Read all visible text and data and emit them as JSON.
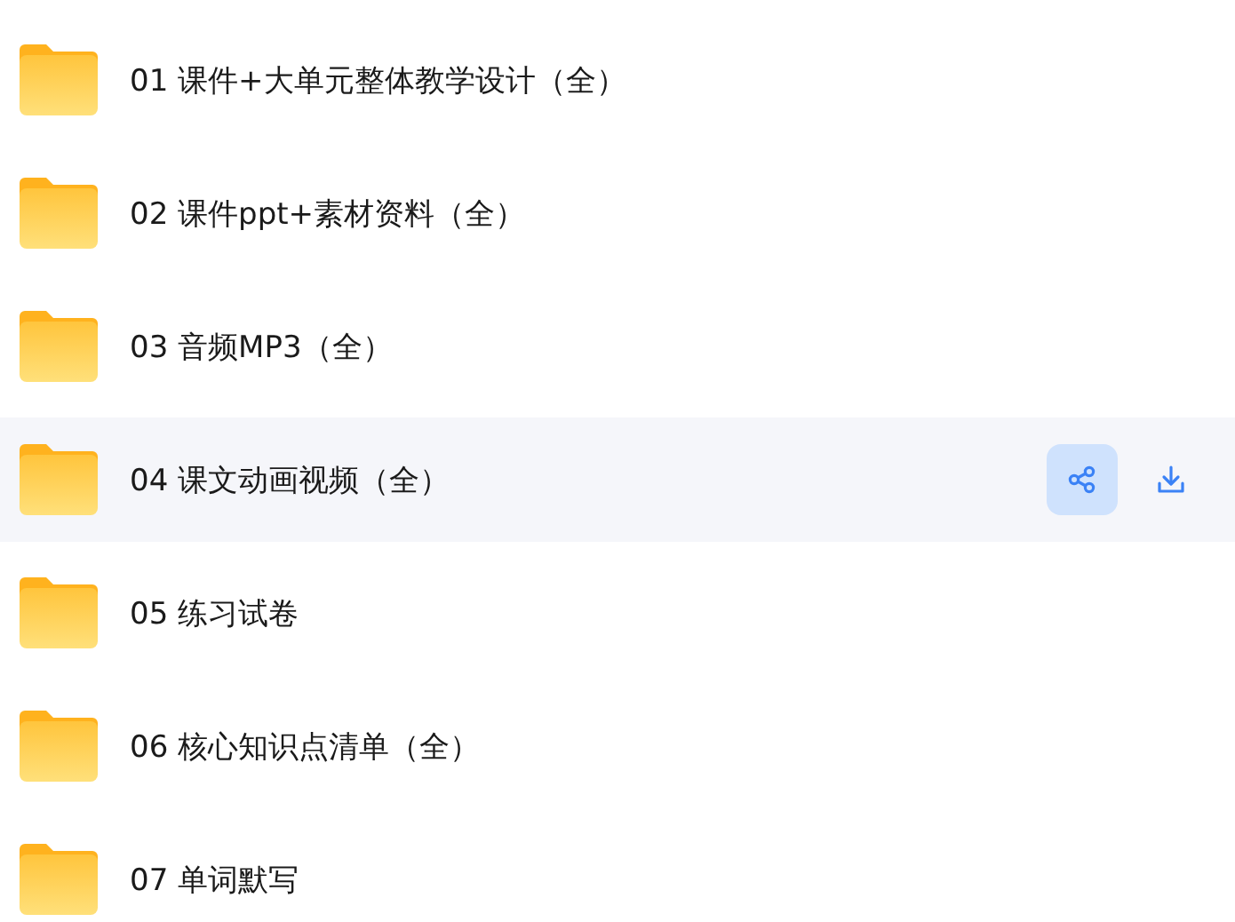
{
  "files": [
    {
      "name": "01 课件+大单元整体教学设计（全）",
      "highlighted": false
    },
    {
      "name": "02 课件ppt+素材资料（全）",
      "highlighted": false
    },
    {
      "name": "03 音频MP3（全）",
      "highlighted": false
    },
    {
      "name": "04 课文动画视频（全）",
      "highlighted": true,
      "share_active": true
    },
    {
      "name": "05 练习试卷",
      "highlighted": false
    },
    {
      "name": "06 核心知识点清单（全）",
      "highlighted": false
    },
    {
      "name": "07 单词默写",
      "highlighted": false
    }
  ]
}
